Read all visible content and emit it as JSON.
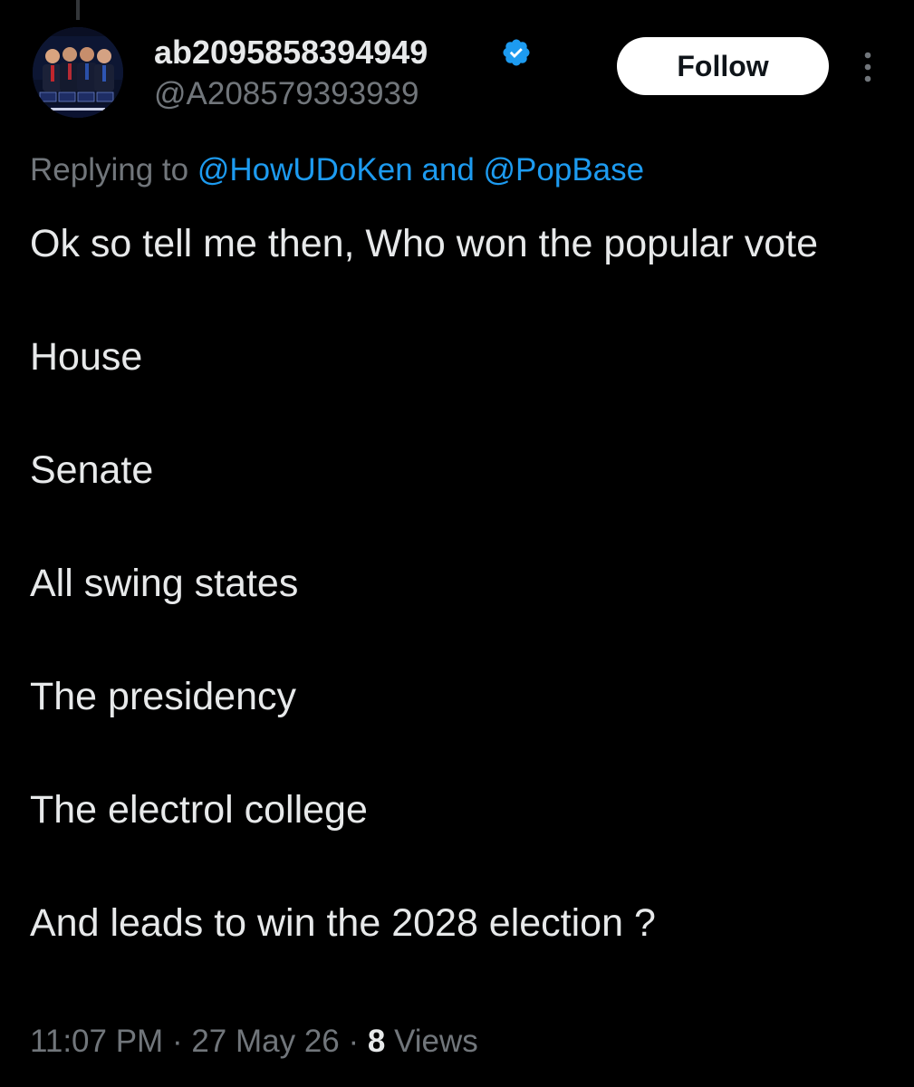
{
  "author": {
    "display_name": "ab2095858394949",
    "handle": "@A208579393939",
    "verified_color": "#1d9bf0"
  },
  "header": {
    "follow_label": "Follow",
    "more_icon": "more-vertical-icon"
  },
  "reply_context": {
    "prefix": "Replying to ",
    "mention_1": "@HowUDoKen",
    "joiner": " and ",
    "mention_2": "@PopBase"
  },
  "tweet": {
    "lines": [
      "Ok so tell me then, Who won the popular vote",
      "House",
      "Senate",
      "All swing states",
      "The presidency",
      "The electrol college",
      "And leads to win the 2028 election ?"
    ]
  },
  "meta": {
    "time": "11:07 PM",
    "separator": " · ",
    "date": "27 May 26",
    "views_count": "8",
    "views_label": " Views"
  },
  "colors": {
    "background": "#000000",
    "text": "#e7e9ea",
    "secondary": "#71767b",
    "accent": "#1d9bf0"
  }
}
